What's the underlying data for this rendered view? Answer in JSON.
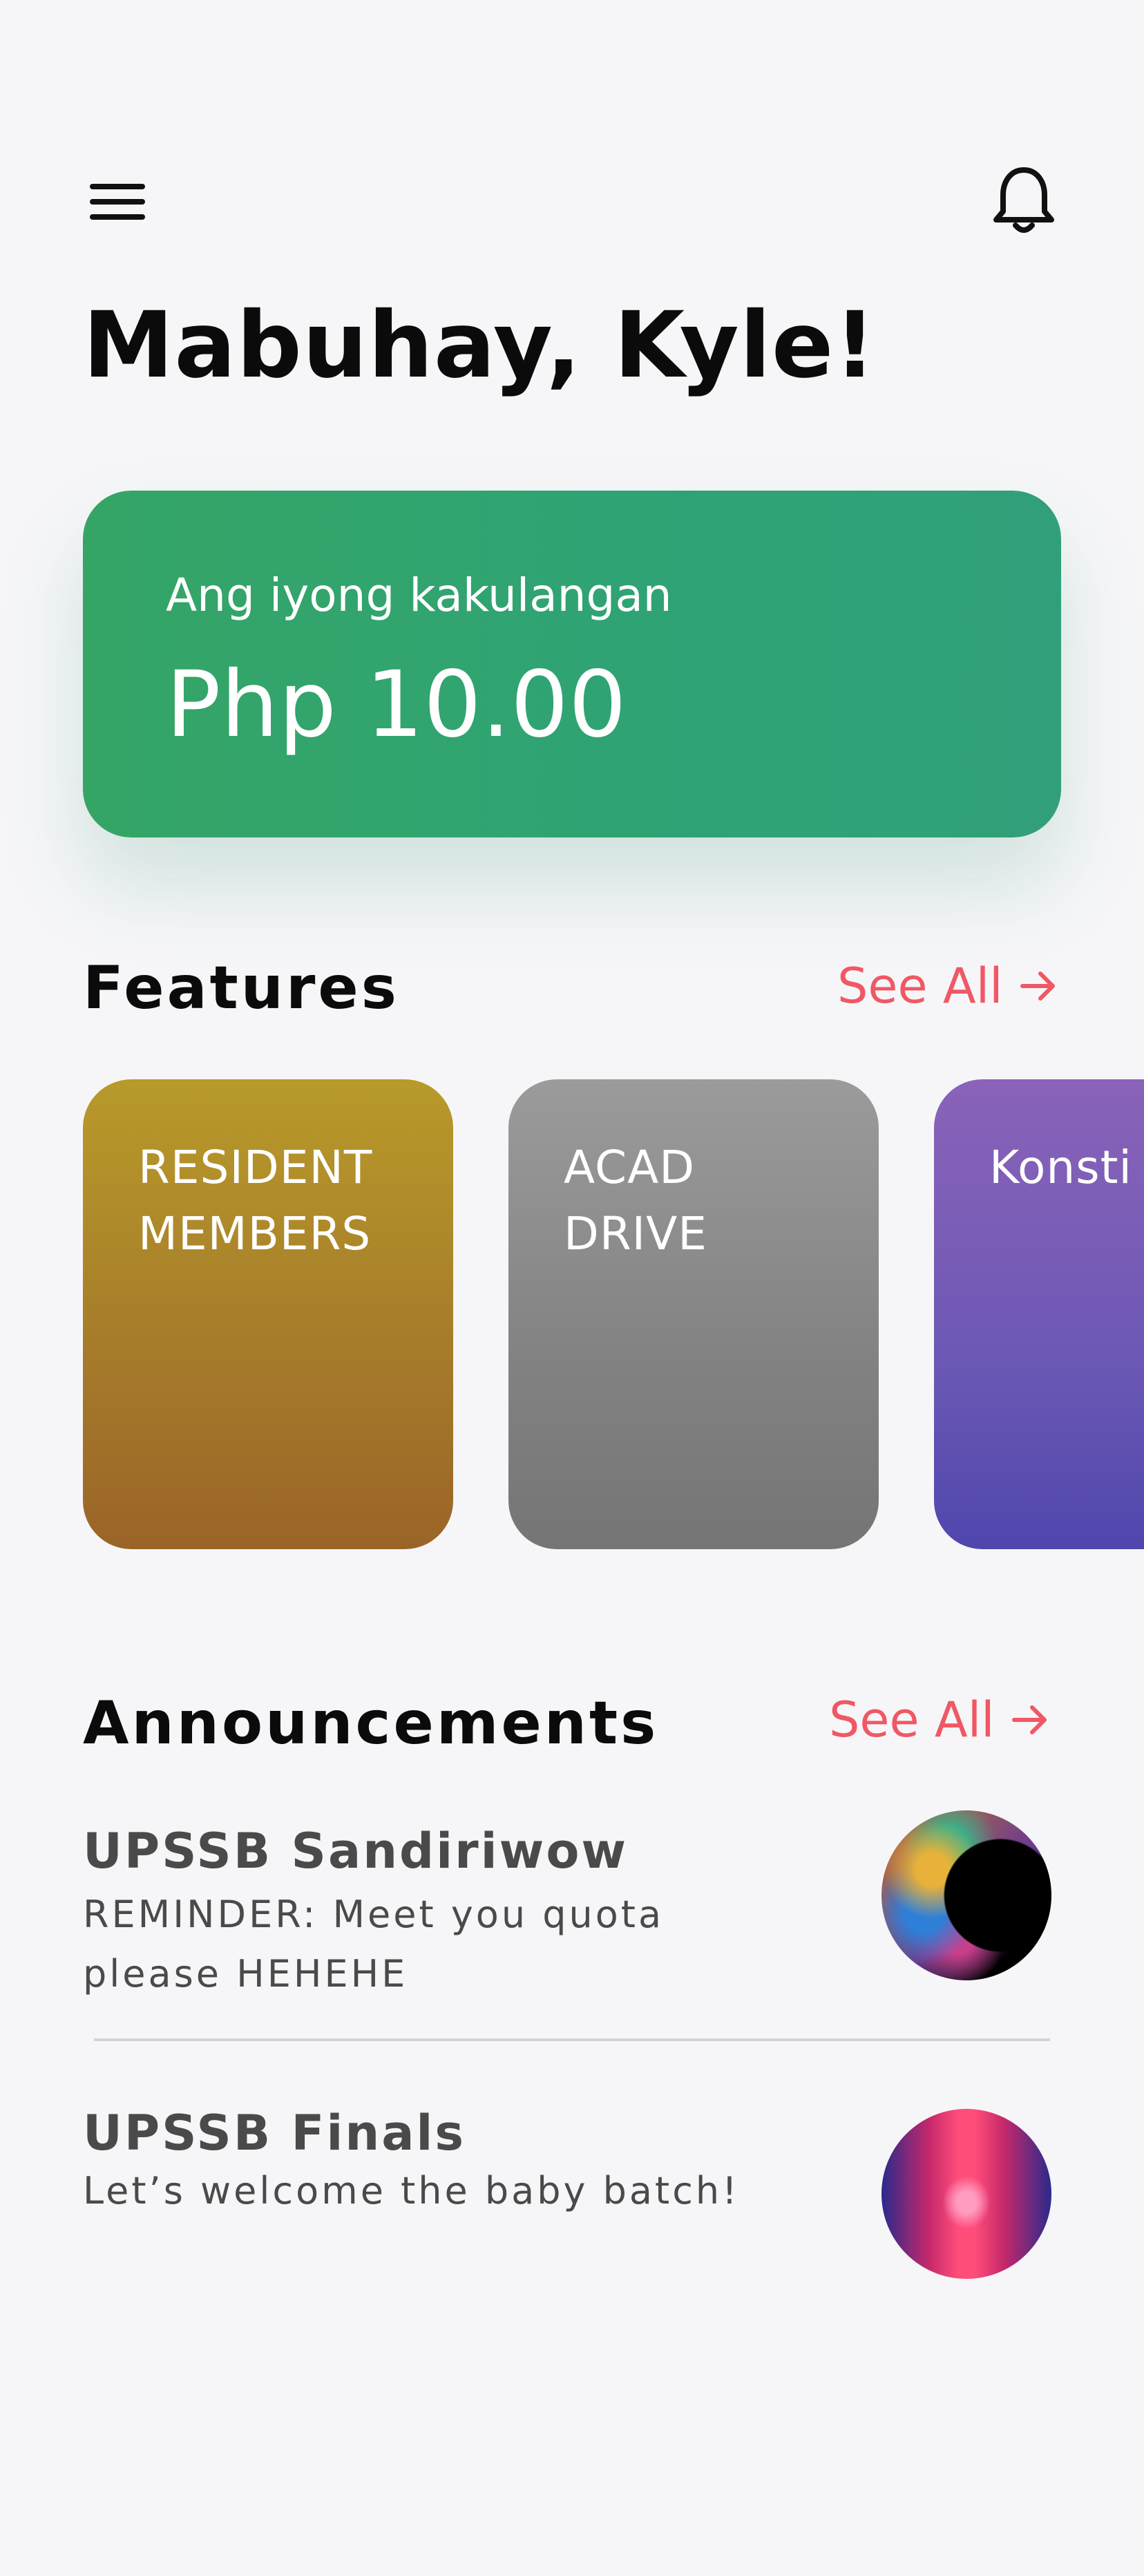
{
  "header": {
    "menu_icon": "hamburger-menu-icon",
    "notification_icon": "bell-icon",
    "greeting": "Mabuhay, Kyle!"
  },
  "balance": {
    "label": "Ang iyong kakulangan",
    "amount": "Php 10.00",
    "color": "#34a36b"
  },
  "features": {
    "title": "Features",
    "see_all": "See All",
    "items": [
      {
        "label": "RESIDENT MEMBERS",
        "color": "#a67d2a"
      },
      {
        "label": "ACAD DRIVE",
        "color": "#858585"
      },
      {
        "label": "Konsti",
        "color": "#6c58b5"
      }
    ]
  },
  "announcements": {
    "title": "Announcements",
    "see_all": "See All",
    "items": [
      {
        "title": "UPSSB Sandiriwow",
        "body": "REMINDER: Meet you quota please HEHEHE",
        "thumbnail": "planet-image"
      },
      {
        "title": "UPSSB Finals",
        "body": "Let’s welcome the baby batch!",
        "thumbnail": "neon-hallway-image"
      }
    ]
  },
  "colors": {
    "background": "#f6f6f8",
    "accent": "#ef5864"
  }
}
